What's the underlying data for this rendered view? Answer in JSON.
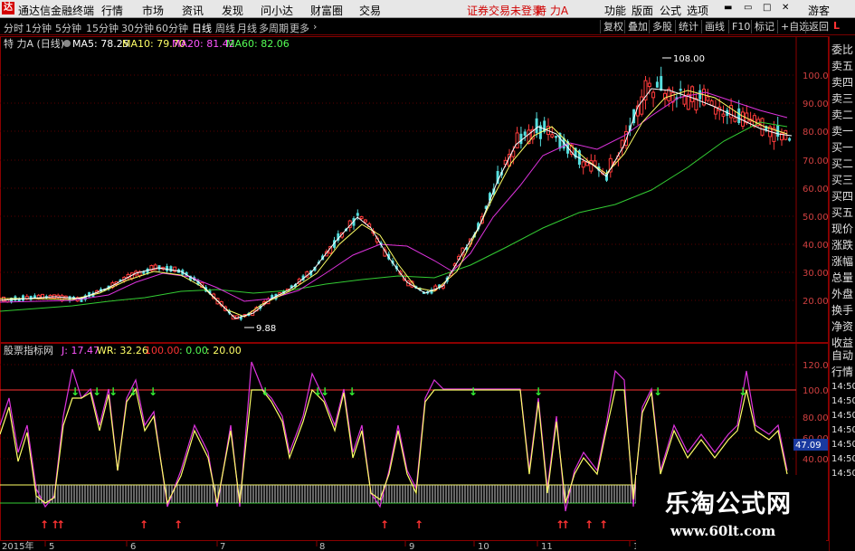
{
  "menubar": {
    "app_title": "通达信金融终端",
    "menus": [
      "行情",
      "市场",
      "资讯",
      "发现",
      "问小达",
      "财富圈",
      "交易"
    ],
    "login_status": "证券交易未登录",
    "security_name": "特 力A",
    "right_buttons": [
      "功能",
      "版面",
      "公式",
      "选项"
    ],
    "guest_label": "游客"
  },
  "toolbar": {
    "periods": [
      "分时",
      "1分钟",
      "5分钟",
      "15分钟",
      "30分钟",
      "60分钟",
      "日线",
      "周线",
      "月线",
      "多周期",
      "更多"
    ],
    "active_period": "日线",
    "right_buttons": [
      "复权",
      "叠加",
      "多股",
      "统计",
      "画线",
      "F10",
      "标记",
      "+自选",
      "返回"
    ]
  },
  "main_chart": {
    "title": "特 力A (日线)",
    "ma_indicators": [
      {
        "label": "MA5: 78.25",
        "color": "#ffffff"
      },
      {
        "label": "MA10: 79.70",
        "color": "#ffff66"
      },
      {
        "label": "MA20: 81.42",
        "color": "#ff55ff"
      },
      {
        "label": "MA60: 82.06",
        "color": "#55ff55"
      }
    ],
    "y_ticks": [
      "100.00",
      "90.00",
      "80.00",
      "70.00",
      "60.00",
      "50.00",
      "40.00",
      "30.00",
      "20.00"
    ],
    "annotations": {
      "high": "108.00",
      "low": "9.88"
    }
  },
  "indicator_panel": {
    "title": "股票指标网",
    "values": [
      {
        "label": "J: 17.47",
        "color": "#ff55ff"
      },
      {
        "label": "WR: 32.26",
        "color": "#ffff66"
      },
      {
        "label": "100.00",
        "color": "#ff3333"
      },
      {
        "label": ": 0.00",
        "color": "#55ff55"
      },
      {
        "label": ": 20.00",
        "color": "#ffff66"
      }
    ],
    "y_ticks": [
      "120.00",
      "100.00",
      "80.00",
      "60.00",
      "40.00"
    ],
    "current_value": "47.09"
  },
  "x_axis": {
    "labels": [
      "2015年",
      "5",
      "6",
      "7",
      "8",
      "9",
      "10",
      "11",
      "12"
    ]
  },
  "right_panel": {
    "labels": [
      "委比",
      "卖五",
      "卖四",
      "卖三",
      "卖二",
      "卖一",
      "买一",
      "买二",
      "买三",
      "买四",
      "买五",
      "现价",
      "涨跌",
      "涨幅",
      "总量",
      "外盘",
      "换手",
      "净资",
      "收益",
      "自动",
      "行情"
    ],
    "times": [
      "14:50",
      "14:50",
      "14:50",
      "14:50",
      "14:50",
      "14:50",
      "14:50"
    ],
    "top_symbol": "L"
  },
  "watermark": {
    "title": "乐淘公式网",
    "url": "www.60lt.com"
  }
}
